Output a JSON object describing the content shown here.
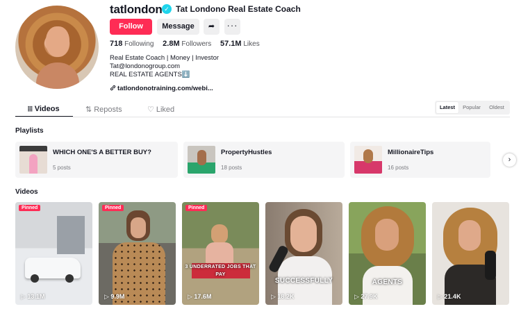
{
  "profile": {
    "handle": "tatlondono",
    "display_name": "Tat Londono Real Estate Coach",
    "verified_glyph": "✓"
  },
  "actions": {
    "follow_label": "Follow",
    "message_label": "Message",
    "share_glyph": "➦",
    "more_glyph": "···"
  },
  "stats": {
    "following_count": "718",
    "following_label": "Following",
    "followers_count": "2.8M",
    "followers_label": "Followers",
    "likes_count": "57.1M",
    "likes_label": "Likes"
  },
  "bio": {
    "line1": "Real Estate Coach | Money | Investor",
    "line2": "Tat@londonogroup.com",
    "line3": "REAL ESTATE AGENTS⬇️",
    "link": "tatlondonotraining.com/webi..."
  },
  "tabs": [
    {
      "label": "Videos",
      "icon": "grid-icon"
    },
    {
      "label": "Reposts",
      "icon": "repost-icon"
    },
    {
      "label": "Liked",
      "icon": "heart-outline-icon"
    }
  ],
  "sort": {
    "latest": "Latest",
    "popular": "Popular",
    "oldest": "Oldest"
  },
  "sections": {
    "playlists": "Playlists",
    "videos": "Videos"
  },
  "playlists": [
    {
      "title": "WHICH ONE'S A BETTER BUY?",
      "count": "5 posts"
    },
    {
      "title": "PropertyHustles",
      "count": "18 posts"
    },
    {
      "title": "MillionaireTips",
      "count": "16 posts"
    }
  ],
  "videos": [
    {
      "pinned": "Pinned",
      "views": "13.1M",
      "caption": ""
    },
    {
      "pinned": "Pinned",
      "views": "9.9M",
      "caption": ""
    },
    {
      "pinned": "Pinned",
      "views": "17.6M",
      "caption": "3 UNDERRATED JOBS THAT PAY"
    },
    {
      "pinned": "",
      "views": "18.2K",
      "caption": "SUCCESSFULLY"
    },
    {
      "pinned": "",
      "views": "27.9K",
      "caption": "AGENTS"
    },
    {
      "pinned": "",
      "views": "21.4K",
      "caption": ""
    }
  ],
  "colors": {
    "accent": "#fe2c55",
    "verified": "#20d5ec",
    "text": "#161823"
  }
}
